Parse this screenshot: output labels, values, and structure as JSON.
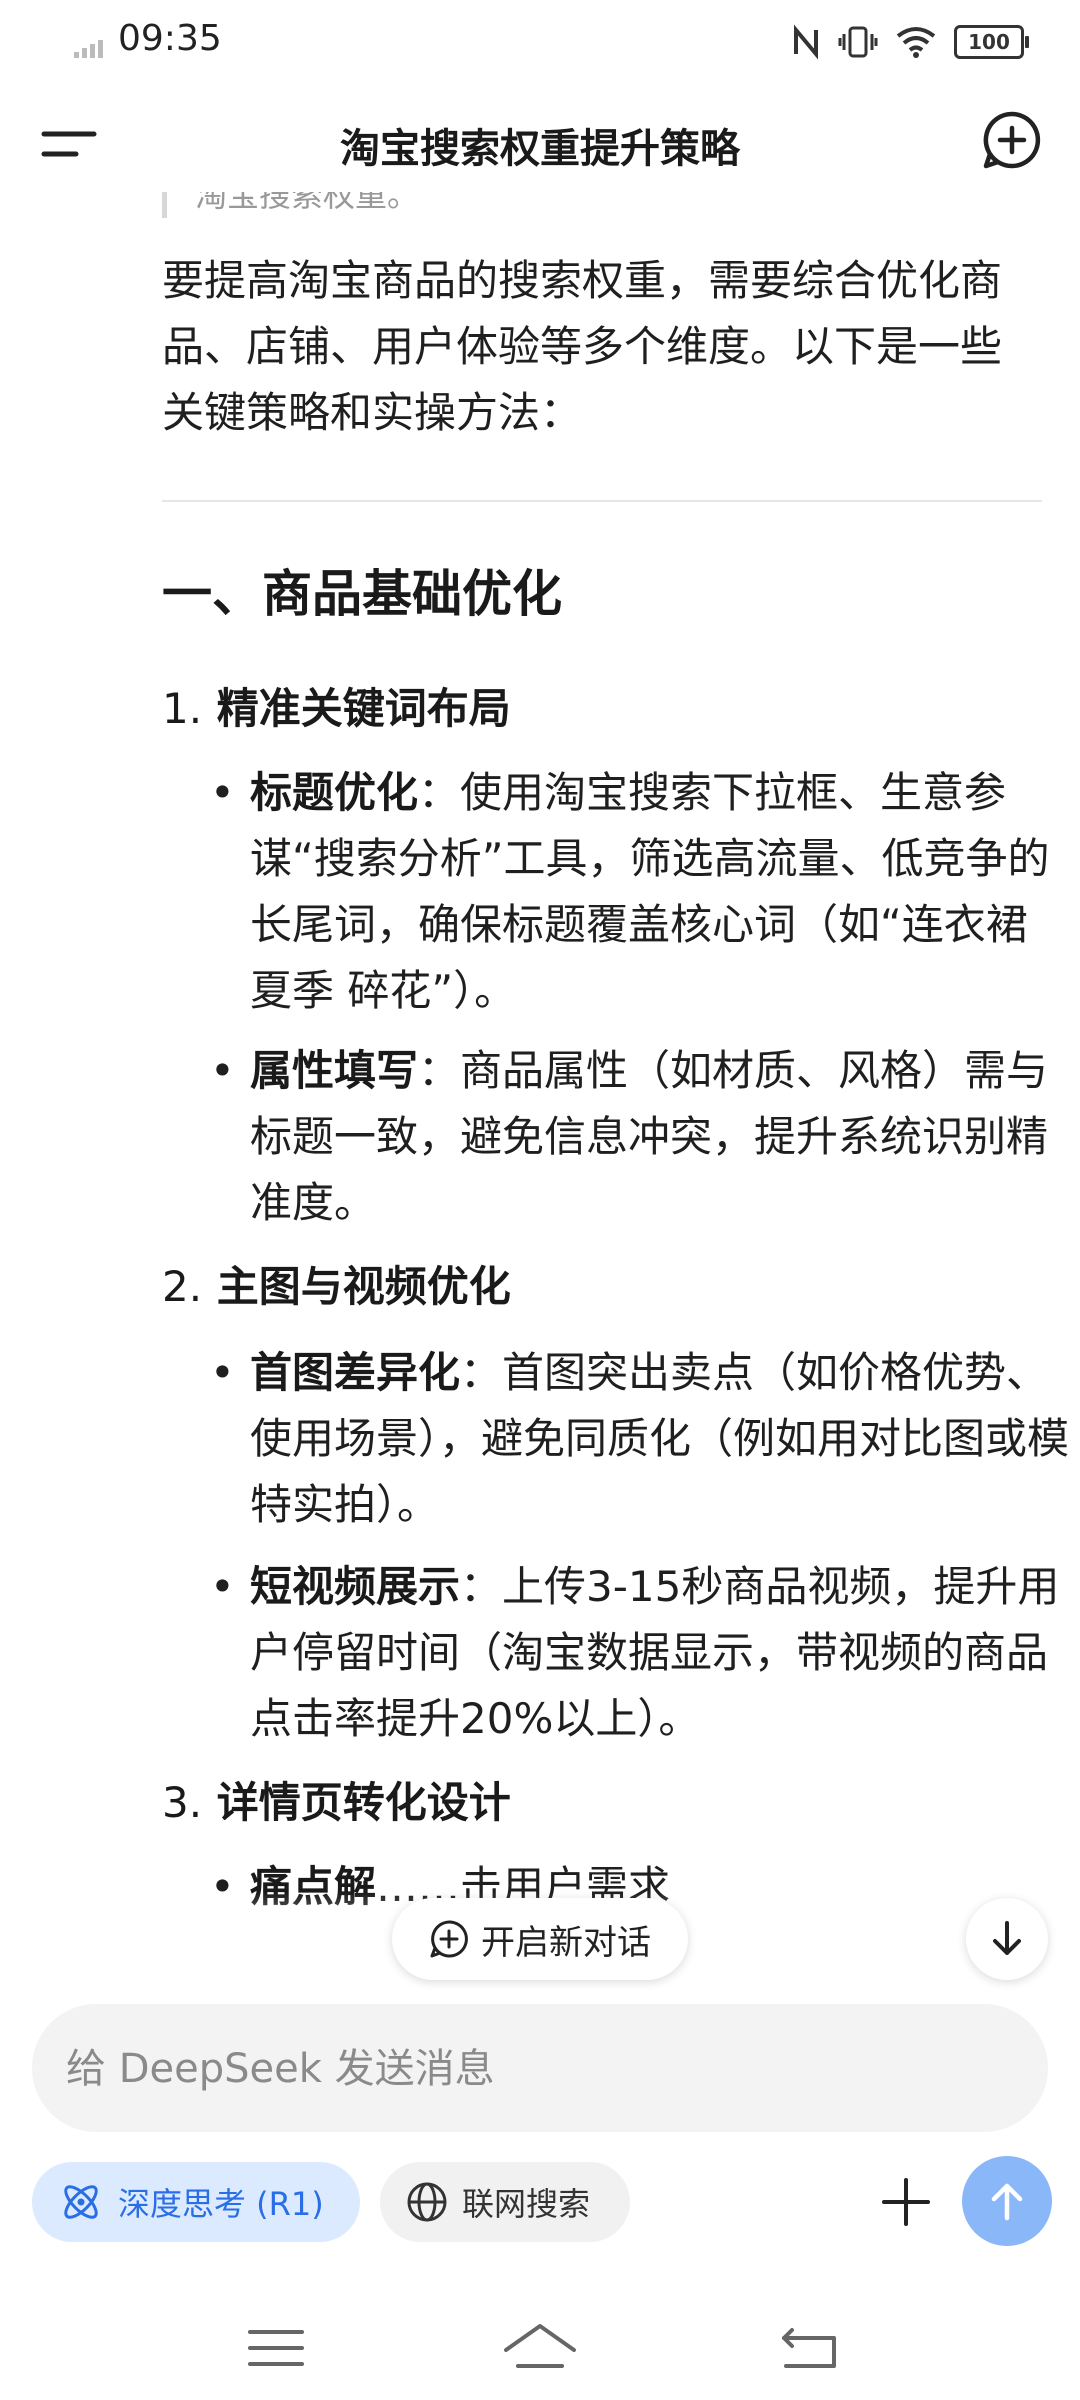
{
  "status_bar": {
    "time": "09:35",
    "battery": "100",
    "icons": [
      "signal-icon",
      "nfc-icon",
      "vibrate-icon",
      "wifi-icon",
      "battery-icon"
    ]
  },
  "header": {
    "title": "淘宝搜索权重提升策略",
    "menu_icon": "menu-icon",
    "new_chat_icon": "new-chat-plus-icon"
  },
  "content": {
    "quote_fragment": "淘宝搜索权重。",
    "intro": "要提高淘宝商品的搜索权重，需要综合优化商品、店铺、用户体验等多个维度。以下是一些关键策略和实操方法：",
    "section_title": "一、商品基础优化",
    "items": [
      {
        "num": "1.",
        "title": "精准关键词布局",
        "bullets": [
          {
            "label": "标题优化",
            "text": "：使用淘宝搜索下拉框、生意参谋“搜索分析”工具，筛选高流量、低竞争的长尾词，确保标题覆盖核心词（如“连衣裙 夏季 碎花”）。"
          },
          {
            "label": "属性填写",
            "text": "：商品属性（如材质、风格）需与标题一致，避免信息冲突，提升系统识别精准度。"
          }
        ]
      },
      {
        "num": "2.",
        "title": "主图与视频优化",
        "bullets": [
          {
            "label": "首图差异化",
            "text": "：首图突出卖点（如价格优势、使用场景），避免同质化（例如用对比图或模特实拍）。"
          },
          {
            "label": "短视频展示",
            "text": "：上传3-15秒商品视频，提升用户停留时间（淘宝数据显示，带视频的商品点击率提升20%以上）。"
          }
        ]
      },
      {
        "num": "3.",
        "title": "详情页转化设计",
        "bullets": [
          {
            "label": "痛点解",
            "text": "……击用户需求"
          }
        ]
      }
    ]
  },
  "floating": {
    "new_conversation": "开启新对话",
    "scroll_down_icon": "arrow-down-icon"
  },
  "composer": {
    "placeholder": "给 DeepSeek 发送消息",
    "deep_think": "深度思考 (R1)",
    "web_search": "联网搜索",
    "attach_icon": "plus-icon",
    "send_icon": "arrow-up-icon"
  },
  "colors": {
    "accent": "#2a6ee6",
    "send_disabled": "#8ab7f7",
    "chip_bg": "#dbeafe"
  }
}
